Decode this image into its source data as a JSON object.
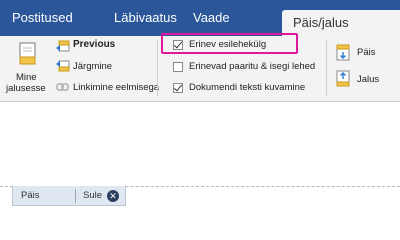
{
  "tabs": {
    "postitused": "Postitused",
    "labivaatus": "Läbivaatus",
    "vaade": "Vaade",
    "active": "Päis/jalus"
  },
  "navigation": {
    "goto_footer": "Mine jalusesse",
    "previous": "Previous",
    "next": "Järgmine",
    "link_previous": "Linkimine eelmisega"
  },
  "options": {
    "different_first_page": "Erinev esilehekülg",
    "different_odd_even": "Erinevad paaritu & isegi lehed",
    "show_document_text": "Dokumendi teksti kuvamine",
    "different_first_page_checked": true,
    "different_odd_even_checked": false,
    "show_document_text_checked": true
  },
  "position": {
    "header": "Päis",
    "footer": "Jalus"
  },
  "footer_tag": {
    "header_label": "Päis",
    "close_label": "Sule",
    "close_symbol": "✕"
  },
  "colors": {
    "tab_bar": "#2b579a",
    "highlight": "#e2189c"
  }
}
